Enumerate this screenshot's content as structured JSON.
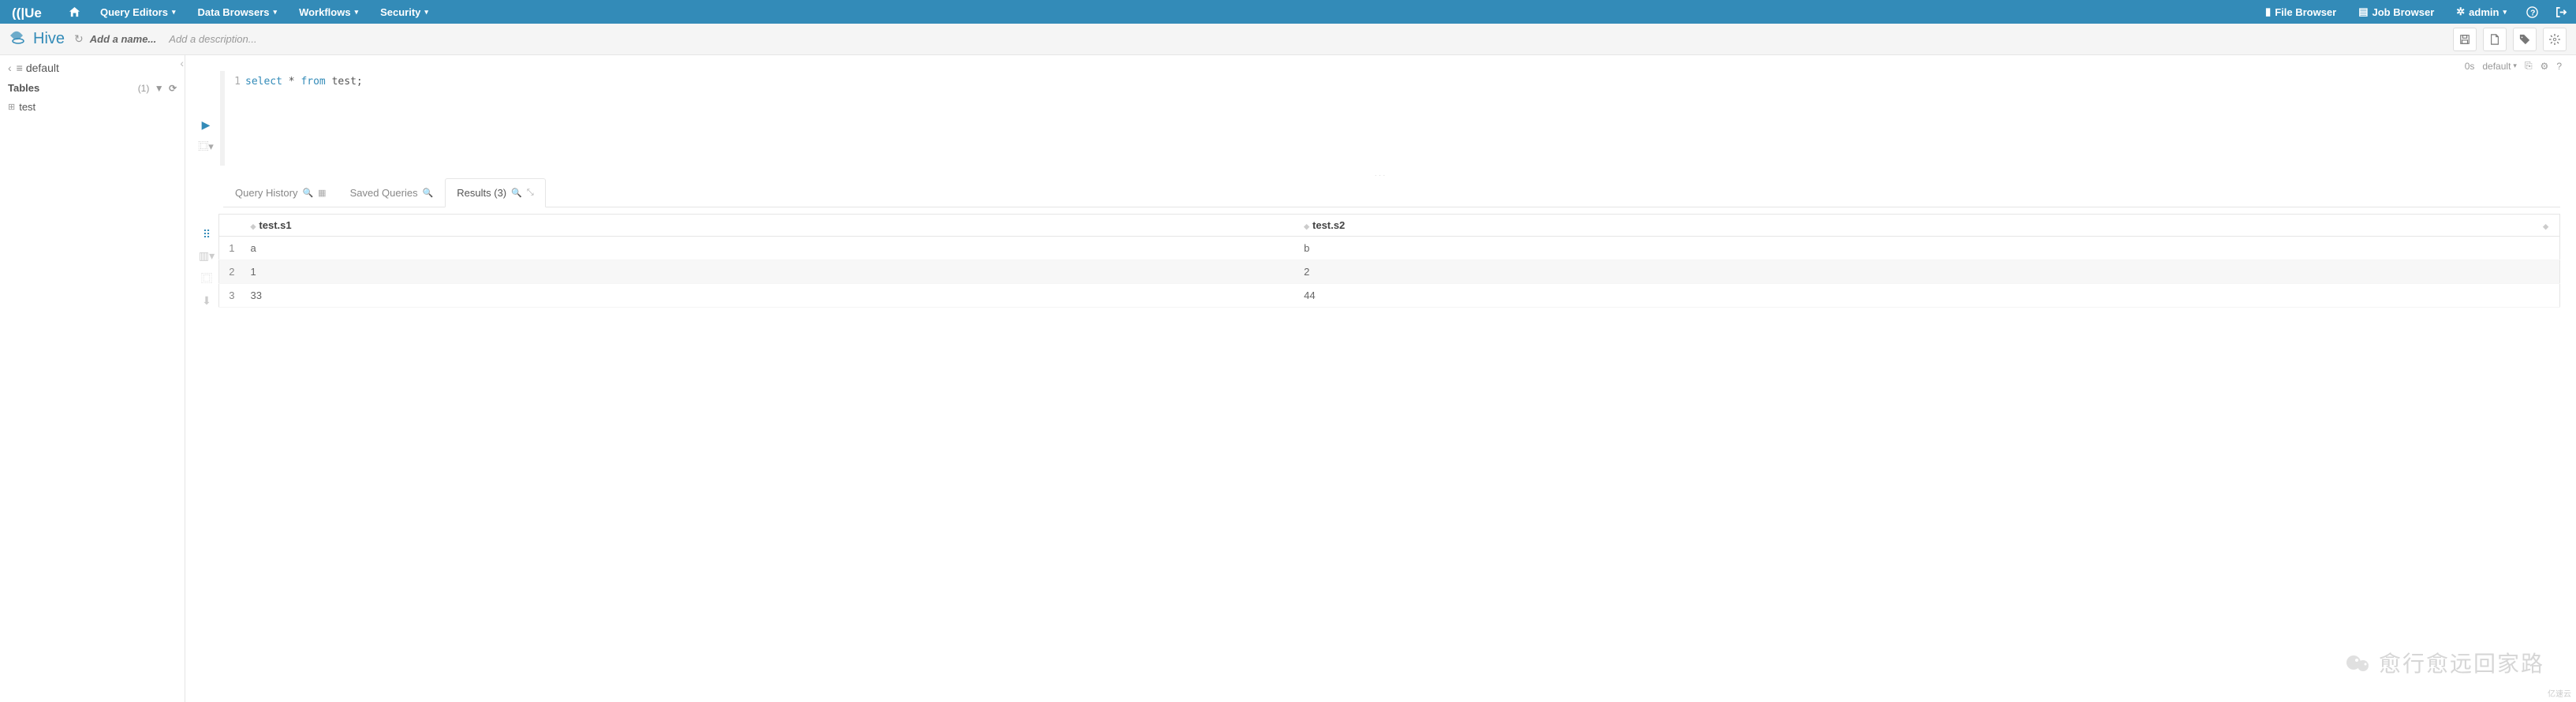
{
  "topnav": {
    "logo_text": "HUE",
    "items": [
      "Query Editors",
      "Data Browsers",
      "Workflows",
      "Security"
    ],
    "file_browser": "File Browser",
    "job_browser": "Job Browser",
    "admin": "admin"
  },
  "subheader": {
    "app_name": "Hive",
    "name_placeholder": "Add a name...",
    "desc_placeholder": "Add a description..."
  },
  "sidebar": {
    "database": "default",
    "tables_header": "Tables",
    "table_count": "(1)",
    "tables": [
      "test"
    ]
  },
  "editor": {
    "time": "0s",
    "db": "default",
    "line_num": "1",
    "sql_select": "select",
    "sql_star": " * ",
    "sql_from": "from",
    "sql_rest": " test;"
  },
  "tabs": {
    "history": "Query History",
    "saved": "Saved Queries",
    "results": "Results (3)"
  },
  "results": {
    "columns": [
      "test.s1",
      "test.s2"
    ],
    "rows": [
      {
        "idx": "1",
        "c1": "a",
        "c2": "b"
      },
      {
        "idx": "2",
        "c1": "1",
        "c2": "2"
      },
      {
        "idx": "3",
        "c1": "33",
        "c2": "44"
      }
    ]
  },
  "watermark": "愈行愈远回家路",
  "watermark2": "亿速云"
}
